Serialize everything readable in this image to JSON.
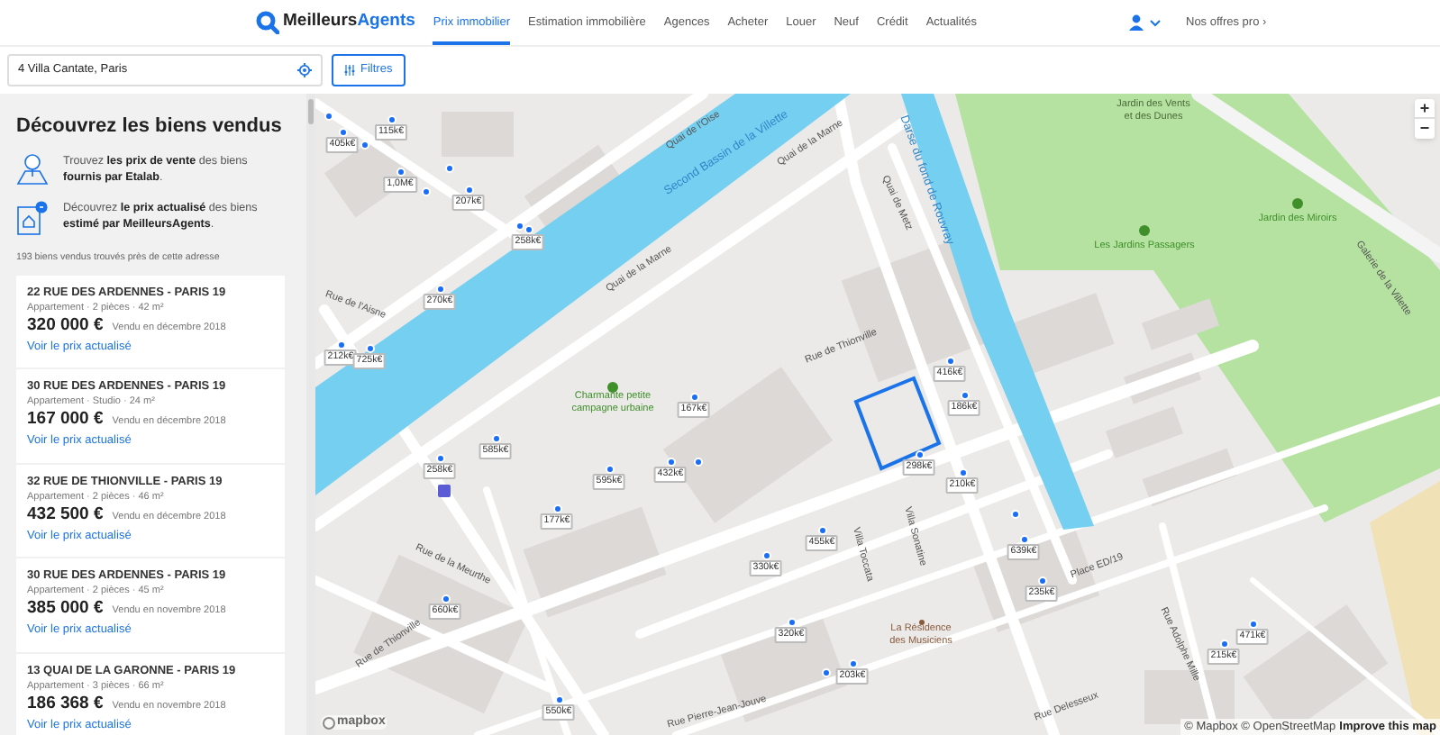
{
  "header": {
    "logo": [
      "Meilleurs",
      "Agents"
    ],
    "nav": [
      {
        "label": "Prix immobilier",
        "selected": true
      },
      {
        "label": "Estimation immobilière",
        "selected": false
      },
      {
        "label": "Agences",
        "selected": false
      },
      {
        "label": "Acheter",
        "selected": false
      },
      {
        "label": "Louer",
        "selected": false
      },
      {
        "label": "Neuf",
        "selected": false
      },
      {
        "label": "Crédit",
        "selected": false
      },
      {
        "label": "Actualités",
        "selected": false
      }
    ],
    "pro_link": "Nos offres pro ›"
  },
  "search": {
    "value": "4 Villa Cantate, Paris",
    "filter_button": "Filtres"
  },
  "sidebar": {
    "title": "Découvrez les biens vendus",
    "info": [
      "Trouvez **les prix de vente** des biens **fournis par Etalab**.",
      "Découvrez **le prix actualisé** des biens **estimé par MeilleursAgents**."
    ],
    "result_count": "193 biens vendus trouvés près de cette adresse",
    "listings": [
      {
        "address": "22 RUE DES ARDENNES - PARIS 19",
        "details": "Appartement · 2 pièces · 42 m²",
        "price": "320 000 €",
        "sold": "Vendu en décembre 2018",
        "link": "Voir le prix actualisé"
      },
      {
        "address": "30 RUE DES ARDENNES - PARIS 19",
        "details": "Appartement · Studio · 24 m²",
        "price": "167 000 €",
        "sold": "Vendu en décembre 2018",
        "link": "Voir le prix actualisé"
      },
      {
        "address": "32 RUE DE THIONVILLE - PARIS 19",
        "details": "Appartement · 2 pièces · 46 m²",
        "price": "432 500 €",
        "sold": "Vendu en décembre 2018",
        "link": "Voir le prix actualisé"
      },
      {
        "address": "30 RUE DES ARDENNES - PARIS 19",
        "details": "Appartement · 2 pièces · 45 m²",
        "price": "385 000 €",
        "sold": "Vendu en novembre 2018",
        "link": "Voir le prix actualisé"
      },
      {
        "address": "13 QUAI DE LA GARONNE - PARIS 19",
        "details": "Appartement · 3 pièces · 66 m²",
        "price": "186 368 €",
        "sold": "Vendu en novembre 2018",
        "link": "Voir le prix actualisé"
      }
    ]
  },
  "map": {
    "markers": [
      {
        "label": "115k€"
      },
      {
        "label": "405k€"
      },
      {
        "label": "1,0M€"
      },
      {
        "label": "207k€"
      },
      {
        "label": "258k€"
      },
      {
        "label": "270k€"
      },
      {
        "label": "212k€"
      },
      {
        "label": "725k€"
      },
      {
        "label": "167k€"
      },
      {
        "label": "585k€"
      },
      {
        "label": "258k€"
      },
      {
        "label": "595k€"
      },
      {
        "label": "432k€"
      },
      {
        "label": "177k€"
      },
      {
        "label": "455k€"
      },
      {
        "label": "330k€"
      },
      {
        "label": "660k€"
      },
      {
        "label": "320k€"
      },
      {
        "label": "203k€"
      },
      {
        "label": "550k€"
      },
      {
        "label": "416k€"
      },
      {
        "label": "186k€"
      },
      {
        "label": "298k€"
      },
      {
        "label": "210k€"
      },
      {
        "label": "639k€"
      },
      {
        "label": "235k€"
      },
      {
        "label": "471k€"
      },
      {
        "label": "215k€"
      }
    ],
    "streets": [
      {
        "name": "Quai de l'Oise",
        "kind": "street"
      },
      {
        "name": "Second Bassin de la Villette",
        "kind": "water"
      },
      {
        "name": "Quai de la Marne",
        "kind": "street"
      },
      {
        "name": "Quai de la Marne",
        "kind": "street"
      },
      {
        "name": "Rue de l'Aisne",
        "kind": "street"
      },
      {
        "name": "Rue de Thionville",
        "kind": "street"
      },
      {
        "name": "Rue de Thionville",
        "kind": "street"
      },
      {
        "name": "Rue de la Meurthe",
        "kind": "street"
      },
      {
        "name": "Quai de Metz",
        "kind": "street"
      },
      {
        "name": "Darse du fond de Rouvray",
        "kind": "water"
      },
      {
        "name": "Villa Toccata",
        "kind": "street"
      },
      {
        "name": "Villa Sonatine",
        "kind": "street"
      },
      {
        "name": "Place ED/19",
        "kind": "street"
      },
      {
        "name": "Rue Adolphe Mille",
        "kind": "street"
      },
      {
        "name": "Rue Delesseux",
        "kind": "street"
      },
      {
        "name": "Rue Pierre-Jean-Jouve",
        "kind": "street"
      },
      {
        "name": "Galerie de la Villette",
        "kind": "street"
      }
    ],
    "places": [
      {
        "name": "Charmante petite campagne urbaine",
        "kind": "park"
      },
      {
        "name": "Jardin des Vents et des Dunes",
        "kind": "label"
      },
      {
        "name": "Les Jardins Passagers",
        "kind": "park"
      },
      {
        "name": "Jardin des Miroirs",
        "kind": "park"
      },
      {
        "name": "La Résidence des Musiciens",
        "kind": "poi"
      }
    ],
    "zoom": [
      "+",
      "−"
    ],
    "mapbox_logo": "mapbox",
    "attribution": "© Mapbox © OpenStreetMap",
    "improve_link": "Improve this map"
  }
}
